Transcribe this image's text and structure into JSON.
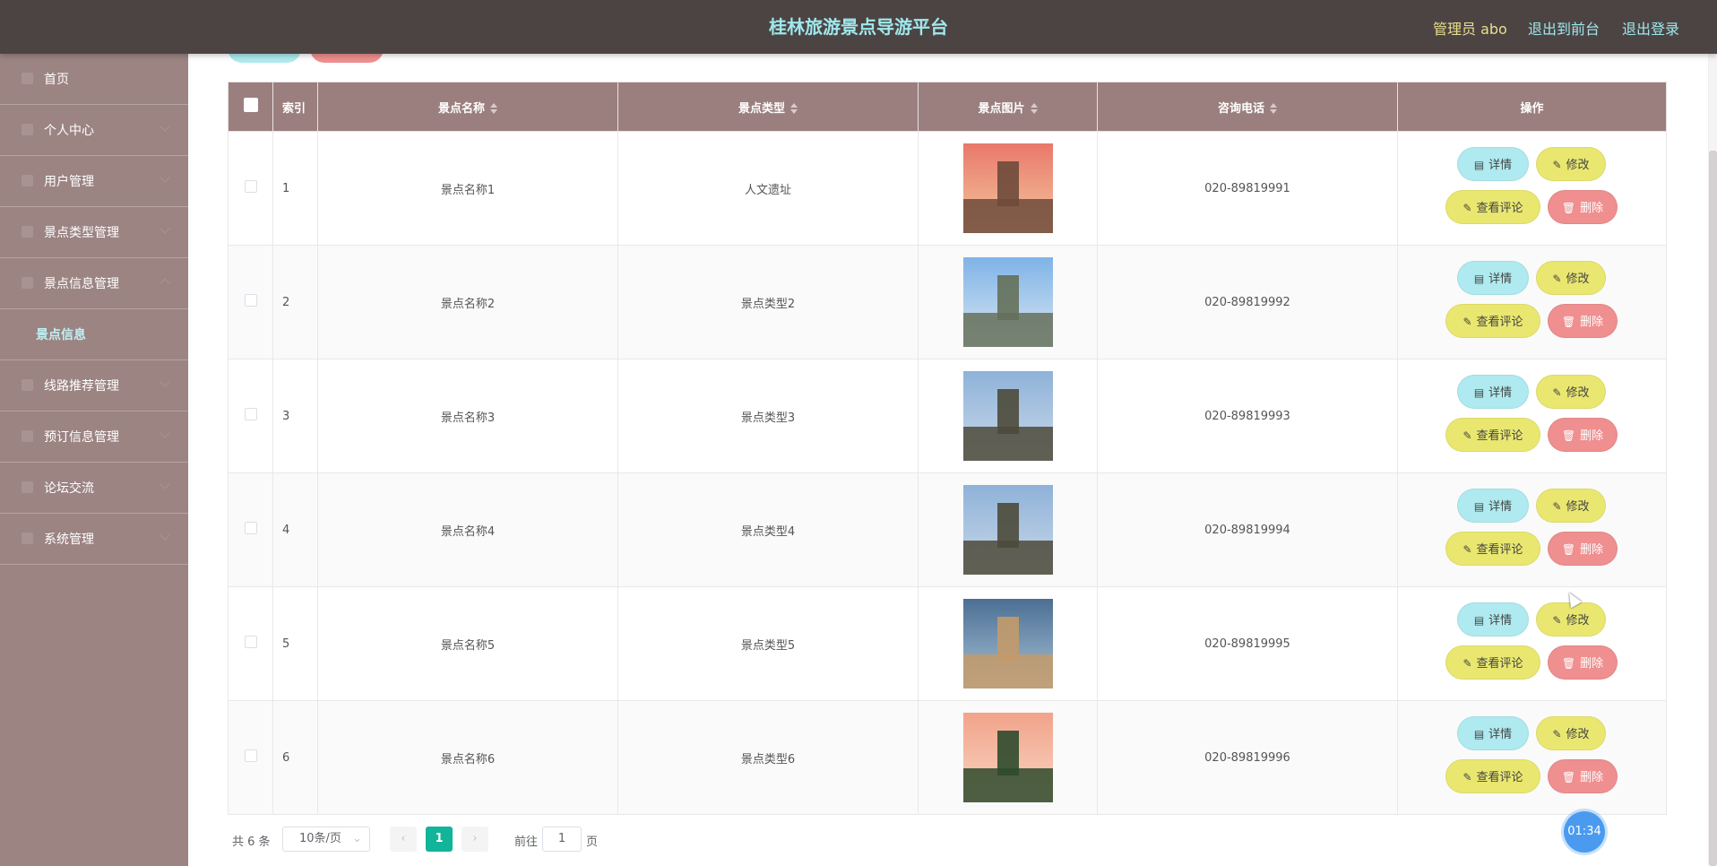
{
  "header": {
    "title": "桂林旅游景点导游平台",
    "user": "管理员 abo",
    "to_front": "退出到前台",
    "logout": "退出登录"
  },
  "sidebar": {
    "items": [
      {
        "label": "首页",
        "icon": "home-icon"
      },
      {
        "label": "个人中心",
        "icon": "user-icon"
      },
      {
        "label": "用户管理",
        "icon": "users-icon"
      },
      {
        "label": "景点类型管理",
        "icon": "category-icon"
      },
      {
        "label": "景点信息管理",
        "icon": "location-icon"
      },
      {
        "label": "线路推荐管理",
        "icon": "route-icon"
      },
      {
        "label": "预订信息管理",
        "icon": "booking-icon"
      },
      {
        "label": "论坛交流",
        "icon": "forum-icon"
      },
      {
        "label": "系统管理",
        "icon": "settings-icon"
      }
    ],
    "sub_item": "景点信息"
  },
  "table": {
    "columns": [
      "索引",
      "景点名称",
      "景点类型",
      "景点图片",
      "咨询电话",
      "操作"
    ],
    "rows": [
      {
        "index": "1",
        "name": "景点名称1",
        "type": "人文遗址",
        "phone": "020-89819991"
      },
      {
        "index": "2",
        "name": "景点名称2",
        "type": "景点类型2",
        "phone": "020-89819992"
      },
      {
        "index": "3",
        "name": "景点名称3",
        "type": "景点类型3",
        "phone": "020-89819993"
      },
      {
        "index": "4",
        "name": "景点名称4",
        "type": "景点类型4",
        "phone": "020-89819994"
      },
      {
        "index": "5",
        "name": "景点名称5",
        "type": "景点类型5",
        "phone": "020-89819995"
      },
      {
        "index": "6",
        "name": "景点名称6",
        "type": "景点类型6",
        "phone": "020-89819996"
      }
    ],
    "actions": {
      "detail": "详情",
      "edit": "修改",
      "review": "查看评论",
      "delete": "删除"
    }
  },
  "pagination": {
    "total": "共 6 条",
    "page_size": "10条/页",
    "current_page": "1",
    "goto_prefix": "前往",
    "goto_value": "1",
    "goto_suffix": "页"
  },
  "timer": "01:34",
  "colors": {
    "header_bg": "#4c4443",
    "sidebar_bg": "#9c8483",
    "table_header_bg": "#9a7f7e",
    "title_color": "#9fe8ec",
    "detail_btn": "#aeeaef",
    "edit_btn": "#e9e76f",
    "delete_btn": "#ef8f8f",
    "active_page": "#12b49a"
  }
}
